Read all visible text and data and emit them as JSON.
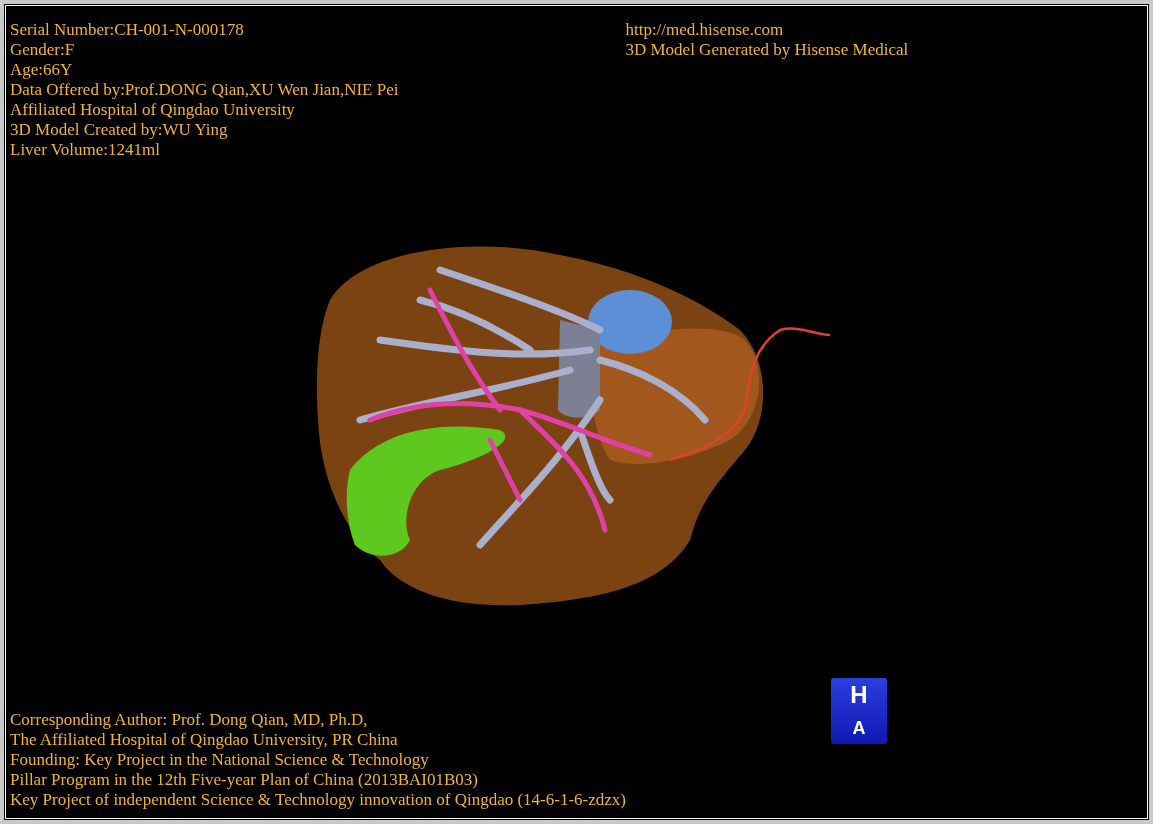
{
  "header_info": [
    "Serial Number:CH-001-N-000178",
    "Gender:F",
    "Age:66Y",
    "Data Offered by:Prof.DONG Qian,XU Wen Jian,NIE Pei",
    "Affiliated Hospital of Qingdao University",
    "3D Model Created by:WU Ying",
    "Liver Volume:1241ml"
  ],
  "source_info": [
    "http://med.hisense.com",
    "3D Model Generated by Hisense Medical"
  ],
  "credits": [
    "Corresponding Author: Prof. Dong Qian, MD, Ph.D,",
    "The Affiliated Hospital of Qingdao University, PR China",
    "Founding: Key Project in the National Science & Technology",
    "Pillar Program in the 12th Five-year Plan of China (2013BAI01B03)",
    "Key Project of independent Science & Technology innovation of Qingdao (14-6-1-6-zdzx)"
  ],
  "orientation_cube": {
    "top": "H",
    "front": "A"
  }
}
